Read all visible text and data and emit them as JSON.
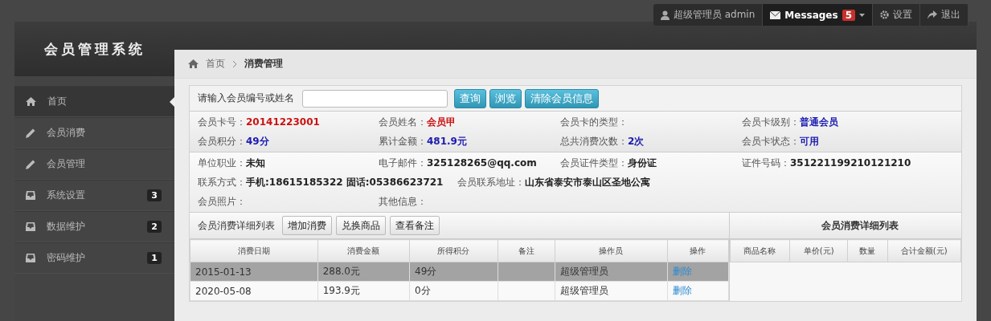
{
  "app_title": "会员管理系统",
  "user_menu": [
    {
      "kind": "user",
      "label": "超级管理员 admin"
    },
    {
      "kind": "messages",
      "label": "Messages",
      "badge": "5"
    },
    {
      "kind": "settings",
      "label": "设置"
    },
    {
      "kind": "logout",
      "label": "退出"
    }
  ],
  "sidebar": {
    "items": [
      {
        "kind": "home",
        "label": "首页",
        "selected": true
      },
      {
        "kind": "edit",
        "label": "会员消费",
        "selected": false
      },
      {
        "kind": "edit",
        "label": "会员管理",
        "selected": false
      },
      {
        "kind": "tray",
        "label": "系统设置",
        "badge": "3",
        "selected": false
      },
      {
        "kind": "tray",
        "label": "数据维护",
        "badge": "2",
        "selected": false
      },
      {
        "kind": "tray",
        "label": "密码维护",
        "badge": "1",
        "selected": false
      }
    ]
  },
  "breadcrumb": [
    "首页",
    "消费管理"
  ],
  "search": {
    "label": "请输入会员编号或姓名",
    "buttons": [
      "查询",
      "浏览",
      "清除会员信息"
    ]
  },
  "info_sections": [
    {
      "rows": [
        {
          "kind": "grid",
          "fields": [
            {
              "label": "会员卡号：",
              "value": "20141223001",
              "color": "#cc1111"
            },
            {
              "label": "会员姓名：",
              "value": "会员甲",
              "color": "#cc1111"
            },
            {
              "label": "会员卡的类型："
            },
            {
              "label": "会员卡级别：",
              "value": "普通会员",
              "color": "#1a1ab0"
            }
          ]
        },
        {
          "kind": "grid",
          "fields": [
            {
              "label": "会员积分：",
              "value": "49分",
              "color": "#1a1ab0"
            },
            {
              "label": "累计金额：",
              "value": "481.9元",
              "color": "#1a1ab0"
            },
            {
              "label": "总共消费次数：",
              "value": "2次",
              "color": "#1a1ab0"
            },
            {
              "label": "会员卡状态：",
              "value": "可用",
              "color": "#1a1ab0"
            }
          ]
        }
      ]
    },
    {
      "rows": [
        {
          "kind": "grid",
          "fields": [
            {
              "label": "单位职业：",
              "value": "未知",
              "color": "#222222"
            },
            {
              "label": "电子邮件：",
              "value": "325128265@qq.com",
              "color": "#222222"
            },
            {
              "label": "会员证件类型：",
              "value": "身份证",
              "color": "#222222"
            },
            {
              "label": "证件号码：",
              "value": "351221199210121210",
              "color": "#222222"
            }
          ]
        },
        {
          "kind": "flow",
          "fields": [
            {
              "label": "联系方式：",
              "value": "手机:18615185322  固话:05386623721",
              "color": "#222222"
            },
            {
              "label": "会员联系地址：",
              "value": "山东省泰安市泰山区圣地公寓",
              "color": "#222222"
            }
          ]
        },
        {
          "kind": "grid",
          "fields": [
            {
              "label": "会员照片："
            },
            {
              "label": "其他信息："
            }
          ]
        }
      ]
    }
  ],
  "consumption": {
    "title": "会员消费详细列表",
    "buttons": [
      "增加消费",
      "兑换商品",
      "查看备注"
    ],
    "columns": [
      "消费日期",
      "消费金额",
      "所得积分",
      "备注",
      "操作员",
      "操作"
    ],
    "rows": [
      {
        "selected": true,
        "cells": [
          "2015-01-13",
          "288.0元",
          "49分",
          "",
          "超级管理员"
        ],
        "action": "删除"
      },
      {
        "selected": false,
        "cells": [
          "2020-05-08",
          "193.9元",
          "0分",
          "",
          "超级管理员"
        ],
        "action": "删除"
      }
    ]
  },
  "detail": {
    "title": "会员消费详细列表",
    "columns": [
      "商品名称",
      "单价(元)",
      "数量",
      "合计金额(元)"
    ]
  }
}
